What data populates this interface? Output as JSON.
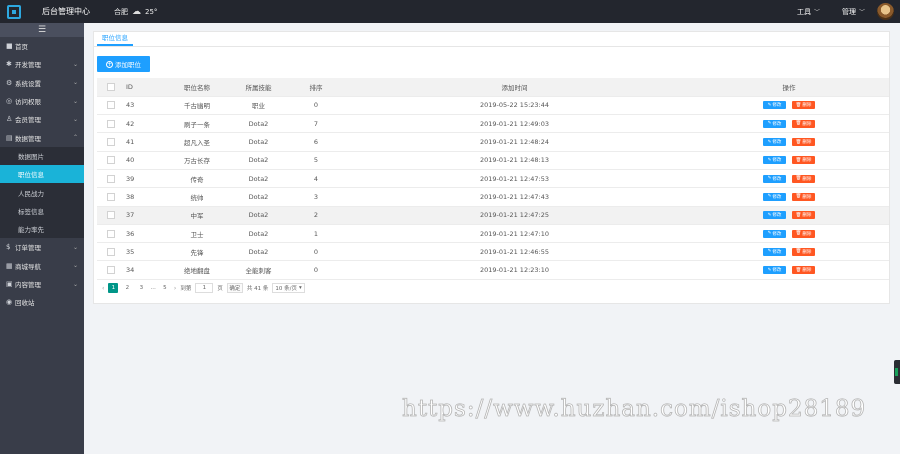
{
  "header": {
    "app_title": "后台管理中心",
    "city": "合肥",
    "weather_icon": "cloud-icon",
    "temperature": "25°",
    "tools_label": "工具",
    "admin_label": "管理"
  },
  "sidebar": {
    "items": [
      {
        "icon": "■",
        "label": "首页",
        "arrow": ""
      },
      {
        "icon": "✱",
        "label": "开发管理",
        "arrow": "⌄"
      },
      {
        "icon": "⚙",
        "label": "系统设置",
        "arrow": "⌄"
      },
      {
        "icon": "◎",
        "label": "访问权限",
        "arrow": "⌄"
      },
      {
        "icon": "♙",
        "label": "会员管理",
        "arrow": "⌄"
      },
      {
        "icon": "▤",
        "label": "数据管理",
        "arrow": "⌃"
      }
    ],
    "subitems": [
      {
        "label": "数据图片",
        "active": false
      },
      {
        "label": "职位信息",
        "active": true
      },
      {
        "label": "人民战力",
        "active": false
      },
      {
        "label": "标签信息",
        "active": false
      },
      {
        "label": "能力率先",
        "active": false
      }
    ],
    "items2": [
      {
        "icon": "$",
        "label": "订单管理",
        "arrow": "⌄"
      },
      {
        "icon": "▦",
        "label": "商城导航",
        "arrow": "⌄"
      },
      {
        "icon": "▣",
        "label": "内容管理",
        "arrow": "⌄"
      },
      {
        "icon": "◉",
        "label": "回收站",
        "arrow": ""
      }
    ]
  },
  "main": {
    "tab_label": "职位信息",
    "add_button_label": "添加职位",
    "columns": [
      "ID",
      "职位名称",
      "所属技能",
      "排序",
      "添加时间",
      "操作"
    ],
    "edit_label": "修改",
    "delete_label": "删除",
    "rows": [
      {
        "id": "43",
        "name": "千古幽明",
        "skill": "职业",
        "sort": "0",
        "time": "2019-05-22 15:23:44"
      },
      {
        "id": "42",
        "name": "刷子一条",
        "skill": "Dota2",
        "sort": "7",
        "time": "2019-01-21 12:49:03"
      },
      {
        "id": "41",
        "name": "超凡入圣",
        "skill": "Dota2",
        "sort": "6",
        "time": "2019-01-21 12:48:24"
      },
      {
        "id": "40",
        "name": "万古长存",
        "skill": "Dota2",
        "sort": "5",
        "time": "2019-01-21 12:48:13"
      },
      {
        "id": "39",
        "name": "传奇",
        "skill": "Dota2",
        "sort": "4",
        "time": "2019-01-21 12:47:53"
      },
      {
        "id": "38",
        "name": "统帅",
        "skill": "Dota2",
        "sort": "3",
        "time": "2019-01-21 12:47:43"
      },
      {
        "id": "37",
        "name": "中军",
        "skill": "Dota2",
        "sort": "2",
        "time": "2019-01-21 12:47:25"
      },
      {
        "id": "36",
        "name": "卫士",
        "skill": "Dota2",
        "sort": "1",
        "time": "2019-01-21 12:47:10"
      },
      {
        "id": "35",
        "name": "先锋",
        "skill": "Dota2",
        "sort": "0",
        "time": "2019-01-21 12:46:55"
      },
      {
        "id": "34",
        "name": "绝地翻盘",
        "skill": "全能刺客",
        "sort": "0",
        "time": "2019-01-21 12:23:10"
      }
    ],
    "highlighted_row": 6
  },
  "pager": {
    "prev": "‹",
    "pages": [
      "1",
      "2",
      "3"
    ],
    "ellipsis": "…",
    "last": "5",
    "next": "›",
    "goto_label": "到第",
    "goto_value": "1",
    "page_unit": "页",
    "confirm": "确定",
    "total": "共 41 条",
    "page_size": "10 条/页"
  },
  "watermark": "https://www.huzhan.com/ishop28189",
  "colors": {
    "accent": "#1e9fff",
    "danger": "#ff5722",
    "pager_current": "#009688",
    "sidebar_active": "#1ab3d8"
  }
}
